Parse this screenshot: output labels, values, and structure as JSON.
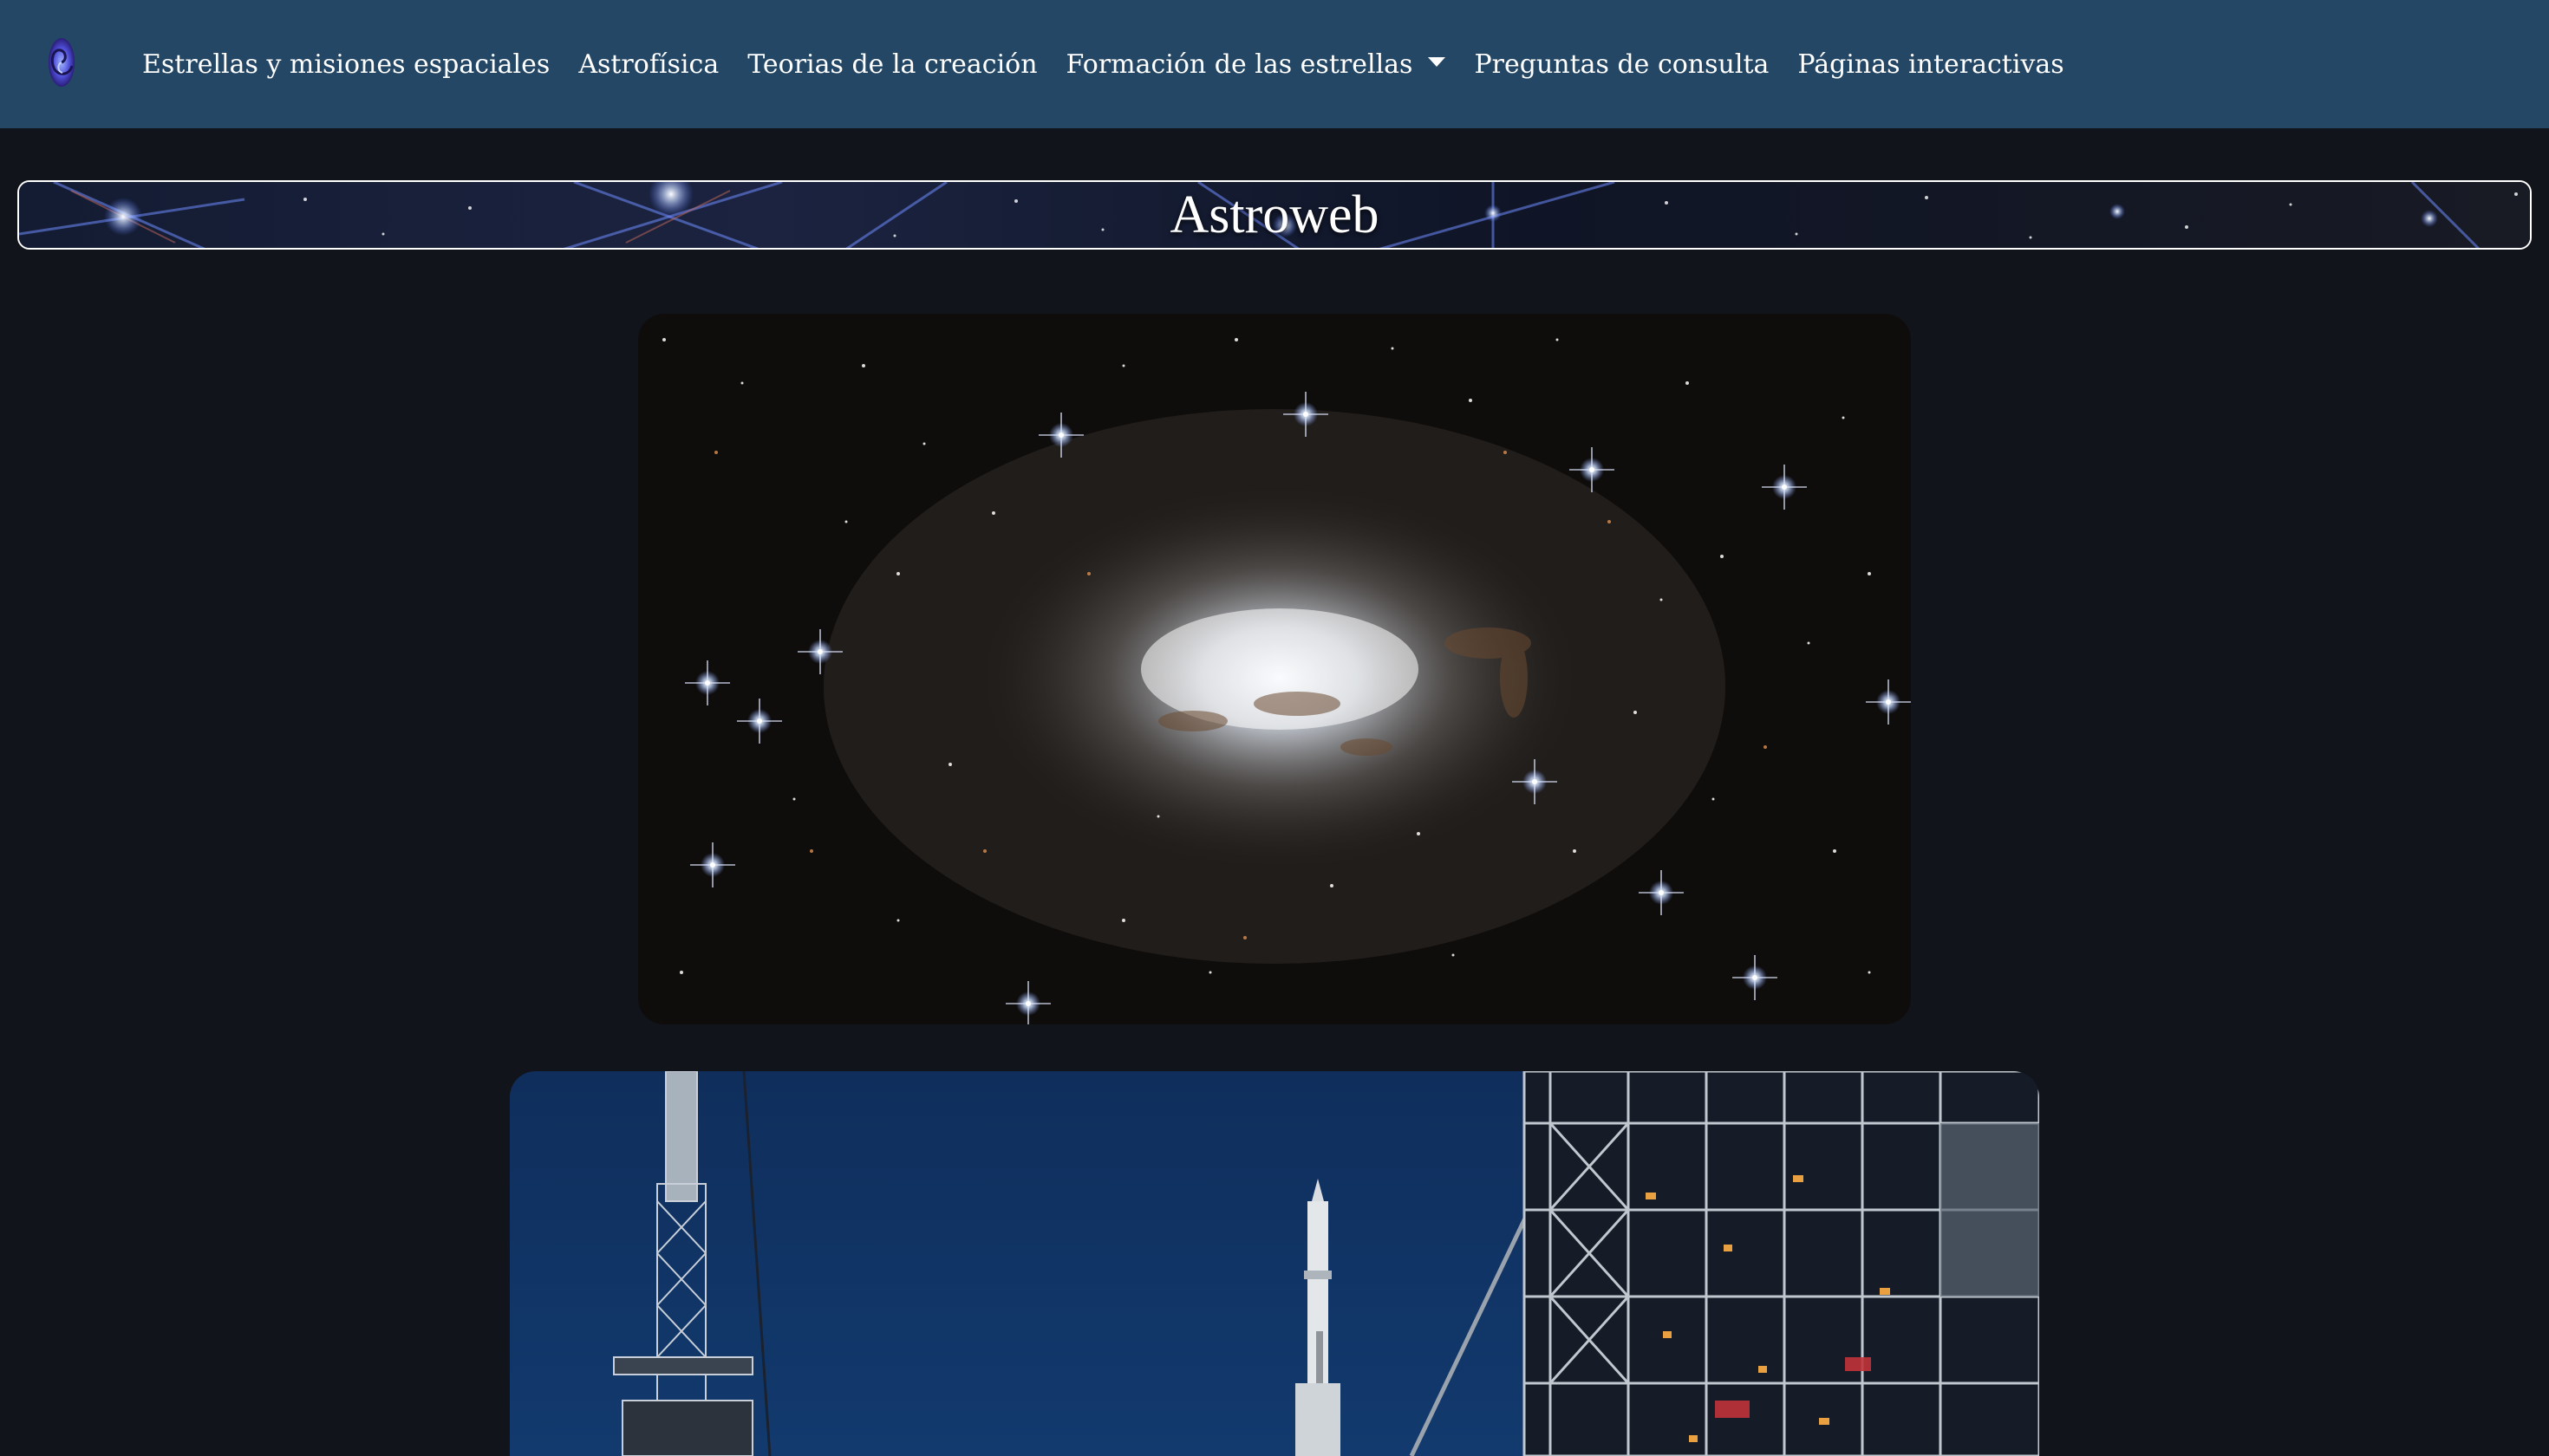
{
  "nav": {
    "logo_icon": "spiral-galaxy-icon",
    "items": [
      {
        "label": "Estrellas y misiones espaciales"
      },
      {
        "label": "Astrofísica"
      },
      {
        "label": "Teorias de la creación"
      },
      {
        "label": "Formación de las estrellas",
        "has_dropdown": true
      },
      {
        "label": "Preguntas de consulta"
      },
      {
        "label": "Páginas interactivas"
      }
    ],
    "background": "#244766"
  },
  "banner": {
    "title": "Astroweb"
  },
  "colors": {
    "page_background": "#11141b",
    "text": "#ffffff"
  }
}
